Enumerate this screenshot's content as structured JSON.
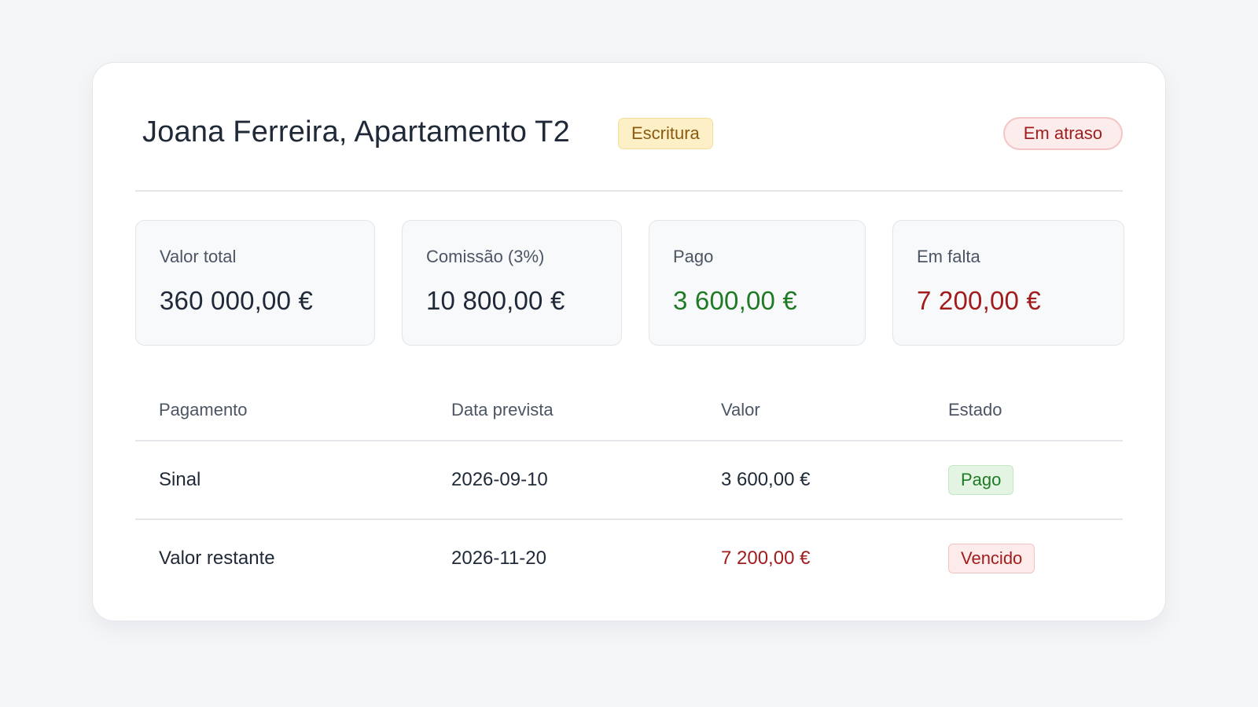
{
  "header": {
    "title": "Joana Ferreira, Apartamento T2",
    "stage": "Escritura",
    "status": "Em atraso"
  },
  "summary": [
    {
      "label": "Valor total",
      "value": "360 000,00 €"
    },
    {
      "label": "Comissão (3%)",
      "value": "10 800,00 €"
    },
    {
      "label": "Pago",
      "value": "3 600,00 €"
    },
    {
      "label": "Em falta",
      "value": "7 200,00 €"
    }
  ],
  "table": {
    "columns": [
      "Pagamento",
      "Data prevista",
      "Valor",
      "Estado"
    ],
    "rows": [
      {
        "payment": "Sinal",
        "due_date": "2026-09-10",
        "amount": "3 600,00 €",
        "status": "Pago"
      },
      {
        "payment": "Valor restante",
        "due_date": "2026-11-20",
        "amount": "7 200,00 €",
        "status": "Vencido"
      }
    ]
  },
  "colors": {
    "paid_green": "#1f7a25",
    "overdue_red": "#a11d1d",
    "stage_amber": "#8a5a10"
  }
}
